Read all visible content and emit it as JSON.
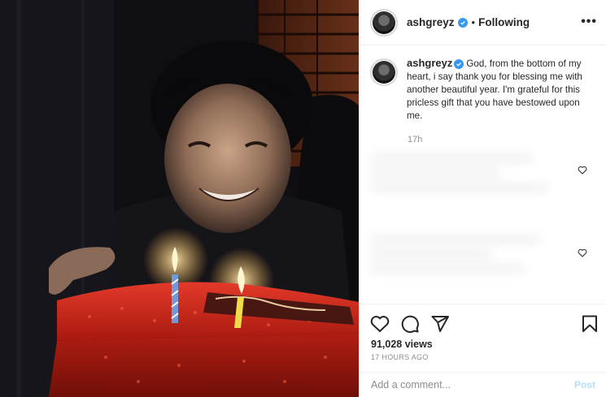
{
  "post": {
    "username": "ashgreyz",
    "follow_separator": "•",
    "follow_state": "Following",
    "more_icon": "more-options-icon",
    "more_label": "•••"
  },
  "caption": {
    "username": "ashgreyz",
    "text": "God, from the bottom of my heart, i say thank you for blessing me with another beautiful year. I'm grateful for this pricless gift that you have bestowed upon me.",
    "time": "17h"
  },
  "stats": {
    "views": "91,028 views",
    "posted_ago": "17 HOURS AGO"
  },
  "comment_box": {
    "placeholder": "Add a comment...",
    "post_label": "Post"
  },
  "colors": {
    "verified": "#3897f0",
    "post_disabled": "#b2dffc",
    "secondary_text": "#8e8e8e",
    "border": "#efefef"
  },
  "icons": [
    "verified-badge-icon",
    "heart-icon",
    "comment-icon",
    "share-icon",
    "bookmark-icon",
    "like-comment-icon"
  ]
}
